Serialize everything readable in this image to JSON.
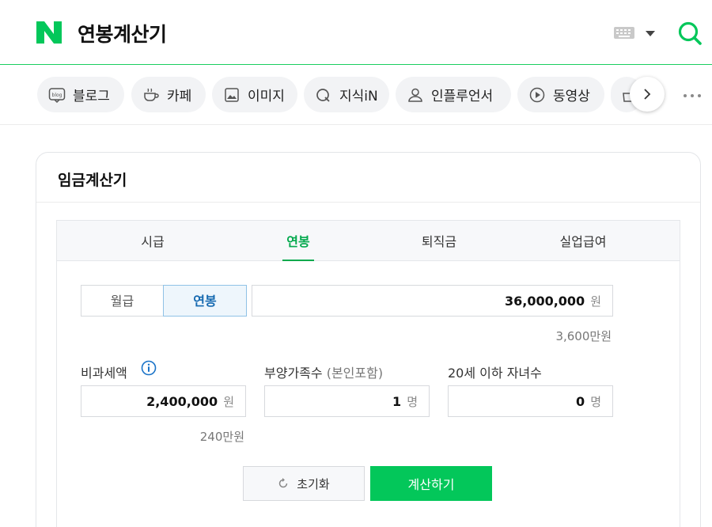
{
  "header": {
    "title": "연봉계산기",
    "logo_icon": "naver-n-logo",
    "brand_color": "#03c75a"
  },
  "nav": {
    "items": [
      {
        "label": "블로그",
        "icon": "blog-icon"
      },
      {
        "label": "카페",
        "icon": "coffee-icon"
      },
      {
        "label": "이미지",
        "icon": "image-icon"
      },
      {
        "label": "지식iN",
        "icon": "knowledge-icon"
      },
      {
        "label": "인플루언서",
        "icon": "person-icon"
      },
      {
        "label": "동영상",
        "icon": "play-icon"
      }
    ]
  },
  "calculator": {
    "title": "임금계산기",
    "tabs": [
      "시급",
      "연봉",
      "퇴직금",
      "실업급여"
    ],
    "active_tab": "연봉",
    "toggle": {
      "monthly": "월급",
      "annual": "연봉",
      "selected": "연봉"
    },
    "salary": {
      "value": "36,000,000",
      "unit": "원",
      "hint": "3,600만원"
    },
    "nontax": {
      "label": "비과세액",
      "value": "2,400,000",
      "unit": "원",
      "hint": "240만원"
    },
    "dependents": {
      "label": "부양가족수",
      "sublabel": "(본인포함)",
      "value": "1",
      "unit": "명"
    },
    "children": {
      "label": "20세 이하 자녀수",
      "value": "0",
      "unit": "명"
    },
    "reset_label": "초기화",
    "calc_label": "계산하기"
  }
}
